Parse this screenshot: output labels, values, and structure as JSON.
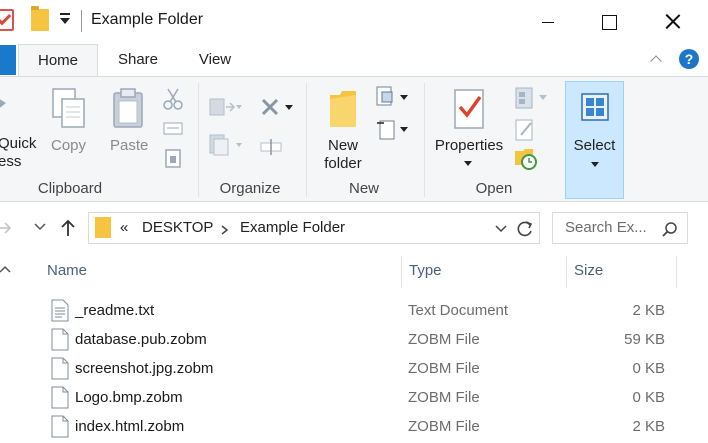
{
  "window": {
    "title": "Example Folder"
  },
  "ribbon_tabs": [
    {
      "label": "Home"
    },
    {
      "label": "Share"
    },
    {
      "label": "View"
    }
  ],
  "help": {
    "label": "?"
  },
  "ribbon": {
    "clipboard": {
      "quick_access_line1": "Quick",
      "quick_access_line2": "ess",
      "copy": "Copy",
      "paste": "Paste",
      "group": "Clipboard"
    },
    "organize": {
      "group": "Organize"
    },
    "new": {
      "new_folder_line1": "New",
      "new_folder_line2": "folder",
      "group": "New"
    },
    "open": {
      "properties": "Properties",
      "group": "Open"
    },
    "select": {
      "label": "Select"
    }
  },
  "address_bar": {
    "overflow": "«",
    "crumbs": [
      "DESKTOP",
      "Example Folder"
    ]
  },
  "search": {
    "placeholder": "Search Ex..."
  },
  "columns": {
    "name": "Name",
    "type": "Type",
    "size": "Size"
  },
  "files": [
    {
      "name": "_readme.txt",
      "type": "Text Document",
      "size": "2 KB",
      "icon": "text-file-icon"
    },
    {
      "name": "database.pub.zobm",
      "type": "ZOBM File",
      "size": "59 KB",
      "icon": "file-icon"
    },
    {
      "name": "screenshot.jpg.zobm",
      "type": "ZOBM File",
      "size": "0 KB",
      "icon": "file-icon"
    },
    {
      "name": "Logo.bmp.zobm",
      "type": "ZOBM File",
      "size": "0 KB",
      "icon": "file-icon"
    },
    {
      "name": "index.html.zobm",
      "type": "ZOBM File",
      "size": "2 KB",
      "icon": "file-icon"
    }
  ]
}
